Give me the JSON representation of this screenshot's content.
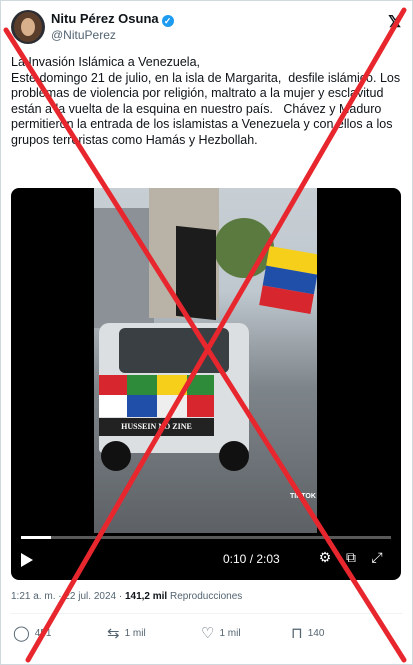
{
  "tweet": {
    "author_name": "Nitu Pérez Osuna",
    "author_handle": "@NituPerez",
    "text": "La Invasión Islámica a Venezuela,\nEste domingo 21 de julio, en la isla de Margarita,  desfile islámico. Los problemas de violencia por religión, maltrato a la mujer y esclavitud están a la vuelta de la esquina en nuestro país.   Chávez y Maduro permitieron la entrada de los islamistas a Venezuela y con ellos a los grupos terroristas como Hamás y Hezbollah.",
    "timestamp": "1:21 a. m. · 22 jul. 2024 · ",
    "views_count": "141,2 mil",
    "views_label": " Reproducciones"
  },
  "video": {
    "time": "0:10 / 2:03",
    "progress": 0.081,
    "banner_text": "HUSSEIN NO ZINE",
    "overlay_tag": "TIKTOK"
  },
  "actions": {
    "replies": "451",
    "reposts": "1 mil",
    "likes": "1 mil",
    "bookmarks": "140"
  },
  "icons": {
    "verified": "verified-badge-icon",
    "x_logo": "x-logo-icon",
    "play": "play-icon",
    "settings": "gear-icon",
    "pip": "picture-in-picture-icon",
    "fullscreen": "fullscreen-icon",
    "reply": "reply-icon",
    "repost": "repost-icon",
    "like": "heart-icon",
    "bookmark": "bookmark-icon"
  },
  "colors": {
    "accent": "#1d9bf0",
    "cross_mark": "#e8262d",
    "text_secondary": "#536471"
  }
}
